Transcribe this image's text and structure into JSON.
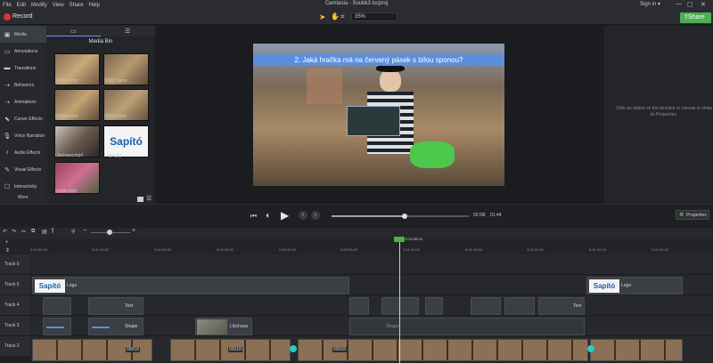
{
  "menu": [
    "File",
    "Edit",
    "Modify",
    "View",
    "Share",
    "Help"
  ],
  "window": {
    "title": "Camtasia - Soubk3.tscproj",
    "signin": "Sign in ▾",
    "min": "—",
    "max": "▢",
    "close": "✕"
  },
  "toolbar": {
    "record": "Record",
    "zoom": "35%",
    "share": "Share"
  },
  "sidebar": {
    "items": [
      {
        "label": "Media",
        "icon": "film-icon"
      },
      {
        "label": "Annotations",
        "icon": "annotation-icon"
      },
      {
        "label": "Transitions",
        "icon": "transition-icon"
      },
      {
        "label": "Behaviors",
        "icon": "behavior-icon"
      },
      {
        "label": "Animations",
        "icon": "animation-icon"
      },
      {
        "label": "Cursor Effects",
        "icon": "cursor-icon"
      },
      {
        "label": "Voice Narration",
        "icon": "mic-icon"
      },
      {
        "label": "Audio Effects",
        "icon": "audio-icon"
      },
      {
        "label": "Visual Effects",
        "icon": "visual-icon"
      },
      {
        "label": "Interactivity",
        "icon": "interactivity-icon"
      }
    ],
    "more": "More"
  },
  "bin": {
    "title": "Media Bin",
    "items": [
      {
        "label": "00016.wmv"
      },
      {
        "label": "00017.wmv"
      },
      {
        "label": "00018.wmv"
      },
      {
        "label": "00019.wmv"
      },
      {
        "label": "Libchava.mp4"
      },
      {
        "label": "Logo.jpg"
      },
      {
        "label": "vyzuk.mp4"
      }
    ]
  },
  "canvas": {
    "question": "2. Jaká hračka má na červený pásek s bílou sponou?"
  },
  "props": {
    "hint": "Click an object on the timeline or canvas to show its Properties."
  },
  "playback": {
    "current": "00:59",
    "total": "01:44",
    "separator": "/",
    "properties": "Properties",
    "progress": 0.53
  },
  "timeline": {
    "ruler": [
      "0:00:00;00",
      "0:00:10;00",
      "0:00:20;00",
      "0:00:30;00",
      "0:00:40;00",
      "0:00:50;00",
      "0:01:00;00",
      "0:01:10;00",
      "0:01:20;00",
      "0:01:30;00",
      "0:01:40;00"
    ],
    "playhead_time": "0:00:58;15",
    "tracks": [
      {
        "label": "Track 6"
      },
      {
        "label": "Track 5"
      },
      {
        "label": "Track 4"
      },
      {
        "label": "Track 3"
      },
      {
        "label": "Track 2"
      }
    ],
    "clips": {
      "logo1": "Logo",
      "logo2": "Logo",
      "text1": "Text",
      "text2": "Text",
      "shape1": "Shape",
      "shape2": "Shape",
      "libchava": "Libchava",
      "v1": "00018",
      "v2": "00018",
      "v3": "00018"
    },
    "logo_text": "Sapító"
  }
}
